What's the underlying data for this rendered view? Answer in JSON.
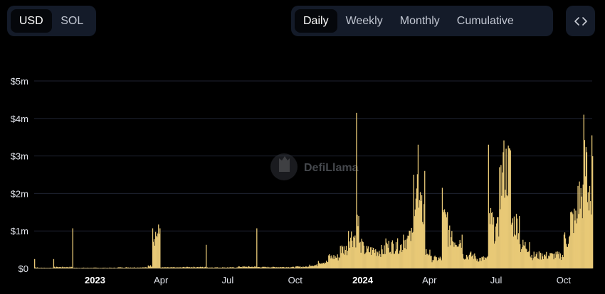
{
  "currency_toggle": {
    "options": [
      "USD",
      "SOL"
    ],
    "selected": "USD"
  },
  "period_toggle": {
    "options": [
      "Daily",
      "Weekly",
      "Monthly",
      "Cumulative"
    ],
    "selected": "Daily"
  },
  "embed_button": {
    "icon": "code-icon"
  },
  "watermark": {
    "text": "DefiLlama",
    "icon": "llama-logo-icon"
  },
  "colors": {
    "bar": "#e8c977",
    "background": "#000000",
    "grid": "#1e2230",
    "panel": "#141b29"
  },
  "chart_data": {
    "type": "bar",
    "title": "",
    "xlabel": "",
    "ylabel": "",
    "ylim": [
      0,
      5000000
    ],
    "y_ticks": [
      {
        "value": 0,
        "label": "$0"
      },
      {
        "value": 1000000,
        "label": "$1m"
      },
      {
        "value": 2000000,
        "label": "$2m"
      },
      {
        "value": 3000000,
        "label": "$3m"
      },
      {
        "value": 4000000,
        "label": "$4m"
      },
      {
        "value": 5000000,
        "label": "$5m"
      }
    ],
    "xlim": [
      "2022-10-10",
      "2024-11-09"
    ],
    "x_ticks": [
      {
        "date": "2023-01-01",
        "label": "2023",
        "bold": true
      },
      {
        "date": "2023-04-01",
        "label": "Apr",
        "bold": false
      },
      {
        "date": "2023-07-01",
        "label": "Jul",
        "bold": false
      },
      {
        "date": "2023-10-01",
        "label": "Oct",
        "bold": false
      },
      {
        "date": "2024-01-01",
        "label": "2024",
        "bold": true
      },
      {
        "date": "2024-04-01",
        "label": "Apr",
        "bold": false
      },
      {
        "date": "2024-07-01",
        "label": "Jul",
        "bold": false
      },
      {
        "date": "2024-10-01",
        "label": "Oct",
        "bold": false
      }
    ],
    "grid": true,
    "series_points": [
      [
        "2022-10-10",
        250000
      ],
      [
        "2022-10-14",
        30000
      ],
      [
        "2022-11-01",
        20000
      ],
      [
        "2022-11-05",
        250000
      ],
      [
        "2022-11-10",
        40000
      ],
      [
        "2022-12-01",
        1070000
      ],
      [
        "2022-12-03",
        20000
      ],
      [
        "2023-02-01",
        30000
      ],
      [
        "2023-03-14",
        80000
      ],
      [
        "2023-03-20",
        1070000
      ],
      [
        "2023-03-30",
        1070000
      ],
      [
        "2023-04-05",
        30000
      ],
      [
        "2023-05-01",
        40000
      ],
      [
        "2023-06-01",
        630000
      ],
      [
        "2023-06-03",
        30000
      ],
      [
        "2023-07-15",
        50000
      ],
      [
        "2023-08-09",
        1070000
      ],
      [
        "2023-08-12",
        40000
      ],
      [
        "2023-10-01",
        50000
      ],
      [
        "2023-10-20",
        100000
      ],
      [
        "2023-11-01",
        200000
      ],
      [
        "2023-11-15",
        350000
      ],
      [
        "2023-12-01",
        600000
      ],
      [
        "2023-12-12",
        1000000
      ],
      [
        "2023-12-23",
        4150000
      ],
      [
        "2023-12-26",
        1400000
      ],
      [
        "2024-01-01",
        700000
      ],
      [
        "2024-01-15",
        550000
      ],
      [
        "2024-02-01",
        800000
      ],
      [
        "2024-02-15",
        700000
      ],
      [
        "2024-02-25",
        900000
      ],
      [
        "2024-03-05",
        1000000
      ],
      [
        "2024-03-10",
        2500000
      ],
      [
        "2024-03-16",
        3300000
      ],
      [
        "2024-03-20",
        1800000
      ],
      [
        "2024-03-25",
        2600000
      ],
      [
        "2024-04-01",
        500000
      ],
      [
        "2024-04-10",
        300000
      ],
      [
        "2024-04-18",
        2150000
      ],
      [
        "2024-04-25",
        1500000
      ],
      [
        "2024-05-01",
        1000000
      ],
      [
        "2024-05-15",
        900000
      ],
      [
        "2024-06-01",
        400000
      ],
      [
        "2024-06-15",
        300000
      ],
      [
        "2024-06-20",
        3300000
      ],
      [
        "2024-06-25",
        1500000
      ],
      [
        "2024-07-01",
        1200000
      ],
      [
        "2024-07-05",
        2700000
      ],
      [
        "2024-07-10",
        3100000
      ],
      [
        "2024-07-20",
        3150000
      ],
      [
        "2024-08-01",
        1400000
      ],
      [
        "2024-08-15",
        700000
      ],
      [
        "2024-09-01",
        400000
      ],
      [
        "2024-09-15",
        400000
      ],
      [
        "2024-10-01",
        900000
      ],
      [
        "2024-10-10",
        1500000
      ],
      [
        "2024-10-20",
        2200000
      ],
      [
        "2024-10-28",
        4100000
      ],
      [
        "2024-11-01",
        3100000
      ],
      [
        "2024-11-05",
        2200000
      ],
      [
        "2024-11-08",
        3550000
      ]
    ]
  }
}
